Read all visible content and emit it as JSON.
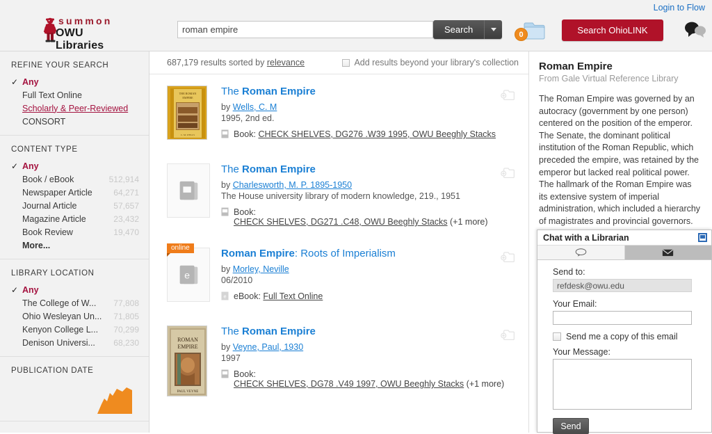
{
  "header": {
    "login_link": "Login to Flow",
    "logo_top": "summon",
    "logo_bottom": "OWU Libraries",
    "search_value": "roman empire",
    "search_placeholder": "Search",
    "search_button": "Search",
    "cart_count": "0",
    "ohiolink_button": "Search OhioLINK",
    "accent_red": "#b01229",
    "badge_orange": "#ef8b1f"
  },
  "sidebar": {
    "groups": [
      {
        "title": "REFINE YOUR SEARCH",
        "items": [
          {
            "label": "Any",
            "count": "",
            "checked": true,
            "style": "any"
          },
          {
            "label": "Full Text Online",
            "count": "",
            "checked": false,
            "style": "plain"
          },
          {
            "label": "Scholarly & Peer-Reviewed",
            "count": "",
            "checked": false,
            "style": "link"
          },
          {
            "label": "CONSORT",
            "count": "",
            "checked": false,
            "style": "plain"
          }
        ]
      },
      {
        "title": "CONTENT TYPE",
        "items": [
          {
            "label": "Any",
            "count": "",
            "checked": true,
            "style": "any"
          },
          {
            "label": "Book / eBook",
            "count": "512,914",
            "checked": false,
            "style": "plain"
          },
          {
            "label": "Newspaper Article",
            "count": "64,271",
            "checked": false,
            "style": "plain"
          },
          {
            "label": "Journal Article",
            "count": "57,657",
            "checked": false,
            "style": "plain"
          },
          {
            "label": "Magazine Article",
            "count": "23,432",
            "checked": false,
            "style": "plain"
          },
          {
            "label": "Book Review",
            "count": "19,470",
            "checked": false,
            "style": "plain"
          },
          {
            "label": "More...",
            "count": "",
            "checked": false,
            "style": "more"
          }
        ]
      },
      {
        "title": "LIBRARY LOCATION",
        "items": [
          {
            "label": "Any",
            "count": "",
            "checked": true,
            "style": "any"
          },
          {
            "label": "The College of W...",
            "count": "77,808",
            "checked": false,
            "style": "plain"
          },
          {
            "label": "Ohio Wesleyan Un...",
            "count": "71,805",
            "checked": false,
            "style": "plain"
          },
          {
            "label": "Kenyon College L...",
            "count": "70,299",
            "checked": false,
            "style": "plain"
          },
          {
            "label": "Denison Universi...",
            "count": "68,230",
            "checked": false,
            "style": "plain"
          }
        ]
      },
      {
        "title": "PUBLICATION DATE",
        "items": []
      }
    ]
  },
  "results_header": {
    "count_prefix": "687,179 results sorted by ",
    "sort_link": "relevance",
    "beyond_label": "Add results beyond your library's collection"
  },
  "results": [
    {
      "title_prefix": "The ",
      "title_highlight": "Roman Empire",
      "title_suffix": "",
      "by_prefix": "by ",
      "author": "Wells, C. M",
      "meta": "1995, 2nd ed.",
      "availability_type": "Book:",
      "availability_link": "CHECK SHELVES, DG276 .W39 1995, OWU Beeghly Stacks",
      "availability_more": "",
      "availability_wrap": false,
      "cover": "roman-empire-yellow",
      "flag": ""
    },
    {
      "title_prefix": "The ",
      "title_highlight": "Roman Empire",
      "title_suffix": "",
      "by_prefix": "by ",
      "author": "Charlesworth, M. P. 1895-1950",
      "meta": "The House university library of modern knowledge, 219., 1951",
      "availability_type": "Book:",
      "availability_link": "CHECK SHELVES, DG271 .C48, OWU Beeghly Stacks",
      "availability_more": "(+1 more)",
      "availability_wrap": true,
      "cover": "placeholder-book",
      "flag": ""
    },
    {
      "title_prefix": "",
      "title_highlight": "Roman Empire",
      "title_suffix": ": Roots of Imperialism",
      "by_prefix": "by ",
      "author": "Morley, Neville",
      "meta": "06/2010",
      "availability_type": "eBook:",
      "availability_link": "Full Text Online",
      "availability_more": "",
      "availability_wrap": false,
      "cover": "placeholder-ebook",
      "flag": "online"
    },
    {
      "title_prefix": "The ",
      "title_highlight": "Roman Empire",
      "title_suffix": "",
      "by_prefix": "by ",
      "author": "Veyne, Paul, 1930",
      "meta": "1997",
      "availability_type": "Book:",
      "availability_link": "CHECK SHELVES, DG78 .V49 1997, OWU Beeghly Stacks",
      "availability_more": "(+1 more)",
      "availability_wrap": true,
      "cover": "roman-empire-veyne",
      "flag": ""
    }
  ],
  "right_panel": {
    "title": "Roman Empire",
    "source": "From Gale Virtual Reference Library",
    "body": "The Roman Empire was governed by an autocracy (government by one person) centered on the position of the emperor. The Senate, the dominant political institution of the Roman Republic, which preceded the empire, was retained by the emperor but lacked real political power. The hallmark of the Roman Empire was its extensive system of imperial administration, which included a hierarchy of magistrates and provincial governors. The Roman Empire refers to the state that was centered in the city of Rome and included vast"
  },
  "chat_widget": {
    "title": "Chat with a Librarian",
    "tab_chat_icon": "chat-bubble-icon",
    "tab_email_icon": "envelope-icon",
    "send_to_label": "Send to:",
    "send_to_value": "refdesk@owu.edu",
    "your_email_label": "Your Email:",
    "your_email_value": "",
    "copy_checkbox_label": "Send me a copy of this email",
    "message_label": "Your Message:",
    "message_value": "",
    "send_button": "Send"
  }
}
